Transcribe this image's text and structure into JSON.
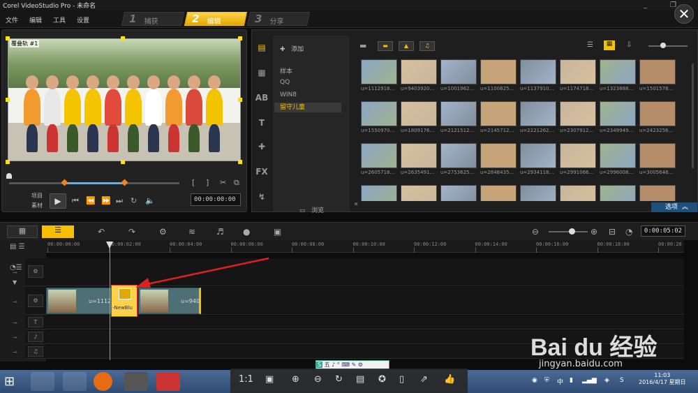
{
  "app": {
    "title": "Corel VideoStudio Pro - 未命名"
  },
  "menu": {
    "items": [
      "文件",
      "编辑",
      "工具",
      "设置"
    ]
  },
  "steps": [
    {
      "num": "1",
      "label": "捕获",
      "active": false
    },
    {
      "num": "2",
      "label": "编辑",
      "active": true
    },
    {
      "num": "3",
      "label": "分享",
      "active": false
    }
  ],
  "window_controls": {
    "minimize": "_",
    "restore": "❐",
    "close": "✕"
  },
  "player": {
    "track_label": "覆叠轨 #1",
    "label_project": "项目",
    "label_clip": "素材",
    "timecode": "00:00:00:00"
  },
  "library": {
    "add_label": "添加",
    "folders": [
      "样本",
      "QQ",
      "WIN8",
      "留守儿童"
    ],
    "selected_folder": "留守儿童",
    "browse_label": "浏览",
    "options_label": "选项",
    "thumb_captions": [
      "u=1112918…",
      "u=9403920…",
      "u=1001962…",
      "u=1100825…",
      "u=1137910…",
      "u=1174718…",
      "u=1323888…",
      "u=1501578…",
      "u=1550970…",
      "u=1809176…",
      "u=2121512…",
      "u=2145712…",
      "u=2221262…",
      "u=2307912…",
      "u=2349949…",
      "u=2423256…",
      "u=2605718…",
      "u=2635491…",
      "u=2753625…",
      "u=2848435…",
      "u=2934118…",
      "u=2991066…",
      "u=2996008…",
      "u=3005648…",
      "",
      "",
      "",
      "",
      "",
      "",
      "",
      ""
    ]
  },
  "timeline": {
    "timecode": "0:00:05:02",
    "ticks": [
      "00:00:00:00",
      "00:00:02:00",
      "00:00:04:00",
      "00:00:06:00",
      "00:00:08:00",
      "00:00:10:00",
      "00:00:12:00",
      "00:00:14:00",
      "00:00:16:00",
      "00:00:18:00",
      "00:00:20"
    ],
    "clip1_caption": "u=1112",
    "transition_caption": "-NewBlu",
    "clip2_caption": "u=940"
  },
  "viewer_bar": {
    "ratio": "1:1"
  },
  "taskbar": {
    "time": "11:03",
    "date": "2016/4/17 星期日"
  },
  "watermark": {
    "logo": "Bai du 经验",
    "url": "jingyan.baidu.com"
  },
  "colors": {
    "accent": "#f5c000",
    "timeline_blue": "#6fa8dc",
    "arrow_red": "#e02020"
  }
}
